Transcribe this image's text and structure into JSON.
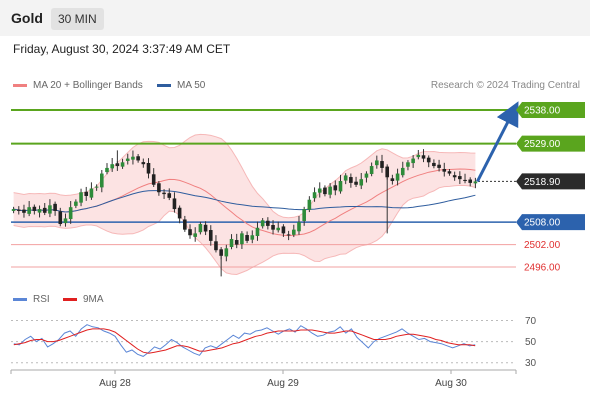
{
  "header": {
    "symbol": "Gold",
    "timeframe": "30 MIN",
    "timestamp": "Friday, August 30, 2024 3:37:49 AM CET"
  },
  "legend": {
    "bb_label": "MA 20 + Bollinger Bands",
    "ma50_label": "MA 50",
    "credit": "Research © 2024 Trading Central"
  },
  "rsi_legend": {
    "rsi_label": "RSI",
    "ma_label": "9MA"
  },
  "colors": {
    "bb": "#f08080",
    "ma50": "#2f5d9e",
    "resistance": "#5aa51e",
    "support": "#2c62ad",
    "minor_support": "#f2a0a0",
    "current": "#333333",
    "arrow": "#2c62ad",
    "rsi": "#5b86d6",
    "rsi_ma": "#e02020"
  },
  "chart_data": [
    {
      "type": "candlestick",
      "title": "",
      "series": [
        {
          "name": "MA 20 + Bollinger Bands"
        },
        {
          "name": "MA 50"
        }
      ],
      "x_tick_labels": [
        "Aug 28",
        "Aug 29",
        "Aug 30"
      ],
      "ylim": [
        2492,
        2542
      ],
      "levels": [
        {
          "value": 2538.0,
          "label": "2538.00",
          "kind": "resistance"
        },
        {
          "value": 2529.0,
          "label": "2529.00",
          "kind": "resistance"
        },
        {
          "value": 2518.9,
          "label": "2518.90",
          "kind": "current"
        },
        {
          "value": 2508.0,
          "label": "2508.00",
          "kind": "support"
        },
        {
          "value": 2502.0,
          "label": "2502.00",
          "kind": "minor_support"
        },
        {
          "value": 2496.0,
          "label": "2496.00",
          "kind": "minor_support"
        }
      ],
      "close_path": [
        2511.5,
        2511.0,
        2510.5,
        2512.0,
        2511.0,
        2511.5,
        2510.5,
        2512.5,
        2511.0,
        2507.5,
        2509.0,
        2512.0,
        2513.5,
        2516.0,
        2515.0,
        2517.0,
        2517.5,
        2521.0,
        2522.5,
        2523.5,
        2523.0,
        2524.0,
        2525.0,
        2525.5,
        2524.5,
        2523.5,
        2521.0,
        2518.0,
        2516.0,
        2515.5,
        2514.5,
        2511.5,
        2509.0,
        2506.0,
        2504.5,
        2505.0,
        2507.5,
        2505.5,
        2503.0,
        2500.5,
        2499.0,
        2501.0,
        2503.5,
        2502.0,
        2505.0,
        2503.0,
        2504.5,
        2506.5,
        2508.5,
        2507.0,
        2506.0,
        2506.5,
        2505.0,
        2504.5,
        2506.0,
        2508.0,
        2511.5,
        2514.0,
        2516.0,
        2517.0,
        2515.5,
        2517.5,
        2516.5,
        2519.0,
        2520.5,
        2518.5,
        2518.0,
        2519.5,
        2521.0,
        2523.0,
        2524.5,
        2522.5,
        2520.0,
        2519.0,
        2521.0,
        2522.5,
        2524.0,
        2525.0,
        2526.0,
        2525.0,
        2524.0,
        2523.0,
        2522.5,
        2521.5,
        2521.0,
        2520.0,
        2519.5,
        2519.0,
        2518.5,
        2518.9
      ],
      "forecast": {
        "from": 2518.9,
        "to": 2538.0
      }
    },
    {
      "type": "line",
      "title": "",
      "series": [
        {
          "name": "RSI",
          "values": [
            48,
            47,
            52,
            55,
            50,
            53,
            45,
            48,
            52,
            58,
            60,
            55,
            62,
            66,
            64,
            63,
            60,
            58,
            55,
            47,
            40,
            42,
            38,
            36,
            40,
            45,
            43,
            47,
            52,
            49,
            45,
            42,
            39,
            37,
            44,
            46,
            44,
            48,
            52,
            56,
            53,
            58,
            57,
            60,
            61,
            63,
            60,
            57,
            60,
            62,
            59,
            65,
            62,
            58,
            55,
            56,
            59,
            60,
            64,
            58,
            62,
            54,
            49,
            44,
            50,
            53,
            55,
            57,
            59,
            62,
            58,
            55,
            52,
            53,
            50,
            49,
            48,
            46,
            44,
            46,
            48,
            46,
            47
          ]
        },
        {
          "name": "9MA",
          "values": [
            47,
            48,
            49,
            51,
            52,
            52,
            50,
            50,
            51,
            53,
            55,
            57,
            59,
            61,
            62,
            62,
            62,
            61,
            59,
            55,
            51,
            47,
            43,
            40,
            39,
            40,
            41,
            42,
            44,
            46,
            46,
            45,
            43,
            41,
            41,
            42,
            43,
            44,
            46,
            48,
            49,
            51,
            53,
            55,
            56,
            58,
            59,
            60,
            60,
            60,
            60,
            61,
            61,
            61,
            60,
            59,
            58,
            58,
            59,
            60,
            60,
            58,
            56,
            54,
            52,
            52,
            52,
            53,
            55,
            56,
            57,
            57,
            56,
            55,
            54,
            52,
            51,
            49,
            48,
            47,
            47,
            47,
            46
          ]
        }
      ],
      "y_tick_labels": [
        "70",
        "50",
        "30"
      ],
      "ylim": [
        25,
        78
      ]
    }
  ]
}
